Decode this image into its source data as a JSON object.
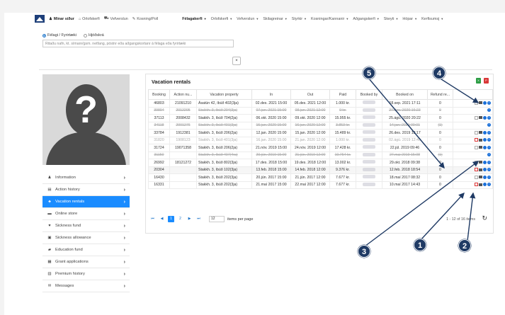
{
  "topnav": {
    "items": [
      {
        "label": "Mínar síður",
        "icon": "user-icon",
        "bold": true
      },
      {
        "label": "Orlofskerfi",
        "icon": "home-icon"
      },
      {
        "label": "Vefverslun",
        "icon": "cart-icon"
      },
      {
        "label": "Kosning/Poll",
        "icon": "edit-icon"
      }
    ],
    "dropdowns": [
      "Félagakerfi",
      "Orlofskerfi",
      "Vefverslun",
      "Skilagreinar",
      "Styrkir",
      "Kosningar/Kannanir",
      "Aðgangskerfi",
      "Skeyti",
      "Hópar",
      "Kerfisumsj"
    ]
  },
  "search": {
    "radio_options": [
      "Félagi / Fyrirtæki",
      "Hjóðskrá"
    ],
    "placeholder": "Ritaðu nafn, kt. símanr/gsm. netfang, póstnr eða aðgangskortanr á félaga eða fyrirtæki",
    "clear_label": "×"
  },
  "sidemenu": [
    {
      "label": "Information",
      "icon": "user-icon",
      "glyph": "♟"
    },
    {
      "label": "Action history",
      "icon": "history-icon",
      "glyph": "▤"
    },
    {
      "label": "Vacation rentals",
      "icon": "rental-icon",
      "glyph": "♣",
      "active": true
    },
    {
      "label": "Online store",
      "icon": "store-icon",
      "glyph": "▬"
    },
    {
      "label": "Sickness fund",
      "icon": "heart-icon",
      "glyph": "♥"
    },
    {
      "label": "Sickness allowance",
      "icon": "allowance-icon",
      "glyph": "▣"
    },
    {
      "label": "Education fund",
      "icon": "education-icon",
      "glyph": "▰"
    },
    {
      "label": "Grant applications",
      "icon": "grant-icon",
      "glyph": "▦"
    },
    {
      "label": "Premium history",
      "icon": "chart-icon",
      "glyph": "▥"
    },
    {
      "label": "Messages",
      "icon": "message-icon",
      "glyph": "✉"
    }
  ],
  "panel": {
    "title": "Vacation rentals",
    "columns": [
      "Booking",
      "Action nu...",
      "Vacation property",
      "In",
      "Out",
      "Paid",
      "Booked by",
      "Booked on",
      "Refund re..."
    ],
    "rows": [
      {
        "booking": "46803",
        "action": "21091210",
        "property": "Ásatún 42, íbúð 402(3ja)",
        "in": "02.des. 2021 15:00",
        "out": "05.des. 2021 12:00",
        "paid": "1.000 kr.",
        "booked_on": "18.sep. 2021 17:11",
        "refund": "0",
        "cancelled": false
      },
      {
        "booking": "39894",
        "action": "2012205",
        "property": "Stakkh. 3, íbúð 204(3ja)",
        "in": "07.jan. 2021 15:00",
        "out": "08.jan. 2021 12:00",
        "paid": "0 kr.",
        "booked_on": "27.des. 2020 16:23",
        "refund": "0",
        "cancelled": true
      },
      {
        "booking": "37113",
        "action": "2008432",
        "property": "Stakkh. 3, íbúð 704(2ja)",
        "in": "06.okt. 2020 15:00",
        "out": "09.okt. 2020 12:00",
        "paid": "15.955 kr.",
        "booked_on": "25.ágú. 2020 20:22",
        "refund": "0",
        "cancelled": false
      },
      {
        "booking": "34118",
        "action": "2001276",
        "property": "Stakkh. 3, íbúð 401(3ja)",
        "in": "15.jan. 2020 15:00",
        "out": "16.jan. 2020 12:00",
        "paid": "3.853 kr.",
        "booked_on": "14.jan. 2020 09:01",
        "refund": "(1)",
        "cancelled": true
      },
      {
        "booking": "33784",
        "action": "1912381",
        "property": "Stakkh. 3, íbúð 206(2ja)",
        "in": "12.jan. 2020 15:00",
        "out": "15.jan. 2020 12:00",
        "paid": "15.489 kr.",
        "booked_on": "26.des. 2019 13:17",
        "refund": "0",
        "cancelled": false
      },
      {
        "booking": "31820",
        "action": "1908123",
        "property": "Stakkh. 3, íbúð 401(3ja)",
        "in": "16.jan. 2020 15:00",
        "out": "21.jan. 2020 12:00",
        "paid": "1.000 kr.",
        "booked_on": "02.ágú. 2019 12:49",
        "refund": "0",
        "cancelled": false,
        "grey": true
      },
      {
        "booking": "31724",
        "action": "19071358",
        "property": "Stakkh. 3, íbúð 206(2ja)",
        "in": "21.nóv. 2019 15:00",
        "out": "24.nóv. 2019 12:00",
        "paid": "17.428 kr.",
        "booked_on": "22.júl. 2019 09:46",
        "refund": "0",
        "cancelled": false
      },
      {
        "booking": "31150",
        "action": "",
        "property": "Stakkh. 3, íbúð 407(4ra)",
        "in": "20.jún. 2019 15:00",
        "out": "21.jún. 2019 12:00",
        "paid": "10.754 kr.",
        "booked_on": "27.mai 2019 15:08",
        "refund": "(1)",
        "cancelled": true
      },
      {
        "booking": "26992",
        "action": "18121272",
        "property": "Stakkh. 3, íbúð 802(3ja)",
        "in": "17.des. 2018 15:00",
        "out": "19.des. 2018 12:00",
        "paid": "13.002 kr.",
        "booked_on": "29.okt. 2018 09:38",
        "refund": "0",
        "cancelled": false
      },
      {
        "booking": "20304",
        "action": "",
        "property": "Stakkh. 3, íbúð 102(3ja)",
        "in": "13.feb. 2018 15:00",
        "out": "14.feb. 2018 12:00",
        "paid": "9.376 kr.",
        "booked_on": "12.feb. 2018 18:54",
        "refund": "0",
        "cancelled": false,
        "highlight": true
      },
      {
        "booking": "16430",
        "action": "",
        "property": "Stakkh. 3, íbúð 202(3ja)",
        "in": "20.jún. 2017 15:00",
        "out": "21.jún. 2017 12:00",
        "paid": "7.677 kr.",
        "booked_on": "18.maí 2017 08:32",
        "refund": "0",
        "cancelled": false
      },
      {
        "booking": "16331",
        "action": "",
        "property": "Stakkh. 3, íbúð 202(3ja)",
        "in": "21.maí 2017 15:00",
        "out": "22.maí 2017 12:00",
        "paid": "7.677 kr.",
        "booked_on": "10.maí 2017 14:43",
        "refund": "0",
        "cancelled": false
      }
    ],
    "pager": {
      "first": "⏮",
      "prev": "◀",
      "pages": [
        "1",
        "2"
      ],
      "next": "▶",
      "last": "⏭",
      "page_size": "12",
      "page_size_label": "items per page",
      "info": "1 - 12 of 16 items"
    },
    "refresh": "↻"
  },
  "callouts": [
    "1",
    "2",
    "3",
    "4",
    "5"
  ],
  "colors": {
    "accent": "#1a8cff",
    "callout": "#1f3a64",
    "pdf": "#d93838",
    "excel": "#2e9e46"
  }
}
